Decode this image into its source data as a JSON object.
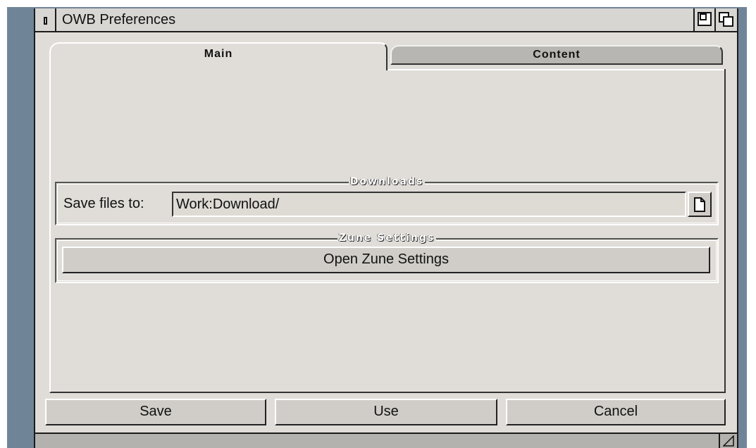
{
  "window": {
    "title": "OWB Preferences"
  },
  "tabs": [
    {
      "label": "Main",
      "active": true
    },
    {
      "label": "Content",
      "active": false
    }
  ],
  "downloads": {
    "group_title": "Downloads",
    "save_label": "Save files to:",
    "path_value": "Work:Download/"
  },
  "zune": {
    "group_title": "Zune Settings",
    "button_label": "Open Zune Settings"
  },
  "actions": {
    "save_label": "Save",
    "use_label": "Use",
    "cancel_label": "Cancel"
  },
  "icons": {
    "close": "close-icon",
    "zoom": "zoom-icon",
    "depth": "depth-icon",
    "popfile": "file-requester-icon",
    "size": "resize-icon"
  },
  "colors": {
    "desktop": "#6f8597",
    "window_bg": "#e0ddd8",
    "button_bg": "#d0cdc8",
    "inactive_tab": "#b8b6b2"
  }
}
